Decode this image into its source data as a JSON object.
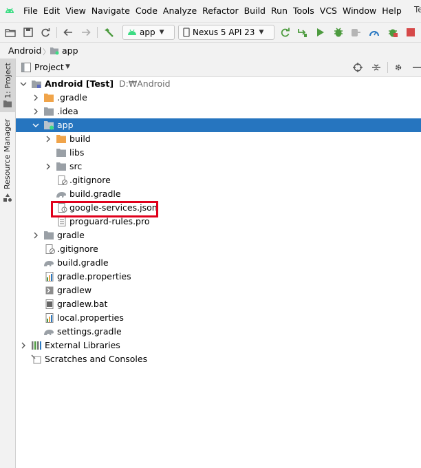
{
  "menu": {
    "items": [
      "File",
      "Edit",
      "View",
      "Navigate",
      "Code",
      "Analyze",
      "Refactor",
      "Build",
      "Run",
      "Tools",
      "VCS",
      "Window",
      "Help"
    ],
    "overflow_text": "Te"
  },
  "toolbar": {
    "run_config": "app",
    "device": "Nexus 5 API 23"
  },
  "breadcrumb": {
    "root": "Android",
    "module": "app"
  },
  "side_tabs": {
    "project": "1: Project",
    "resource_manager": "Resource Manager"
  },
  "project_panel": {
    "title": "Project"
  },
  "tree": {
    "root": {
      "name": "Android [Test]",
      "path": "D:₩Android"
    },
    "gradle_dir": ".gradle",
    "idea_dir": ".idea",
    "app": "app",
    "build": "build",
    "libs": "libs",
    "src": "src",
    "app_gitignore": ".gitignore",
    "app_build_gradle": "build.gradle",
    "google_services": "google-services.json",
    "proguard": "proguard-rules.pro",
    "gradle": "gradle",
    "root_gitignore": ".gitignore",
    "root_build_gradle": "build.gradle",
    "gradle_properties": "gradle.properties",
    "gradlew": "gradlew",
    "gradlew_bat": "gradlew.bat",
    "local_properties": "local.properties",
    "settings_gradle": "settings.gradle",
    "external_libraries": "External Libraries",
    "scratches": "Scratches and Consoles"
  },
  "colors": {
    "selection": "#2675bf",
    "highlight_box": "#e0001b",
    "folder_orange": "#f0a44a",
    "folder_gray": "#9aa0a6",
    "android_green": "#3ddc84"
  }
}
